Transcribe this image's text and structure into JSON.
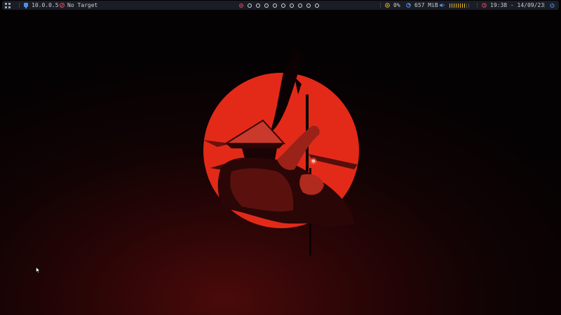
{
  "topbar": {
    "ip": "10.0.0.5",
    "target": "No Target",
    "workspaces": [
      {
        "active": true
      },
      {
        "active": false
      },
      {
        "active": false
      },
      {
        "active": false
      },
      {
        "active": false
      },
      {
        "active": false
      },
      {
        "active": false
      },
      {
        "active": false
      },
      {
        "active": false
      },
      {
        "active": false
      }
    ],
    "cpu": "0%",
    "memory": "657 MiB",
    "volume_level": 0.8,
    "clock": "19:38 - 14/09/23",
    "icons": {
      "menu": "menu-grid-icon",
      "ip": "network-icon",
      "target": "target-icon",
      "cpu": "cpu-icon",
      "memory": "memory-icon",
      "volume": "volume-icon",
      "clock": "clock-icon",
      "power": "power-icon"
    },
    "colors": {
      "bar_bg": "#1a1d25",
      "text": "#c9cdd6",
      "accent_red": "#e0455a",
      "accent_yellow": "#e6b422",
      "accent_blue": "#4f8fe6"
    }
  },
  "wallpaper": {
    "subject": "samurai-silhouette",
    "sun_color": "#e32a19",
    "background_color": "#2a0506"
  }
}
